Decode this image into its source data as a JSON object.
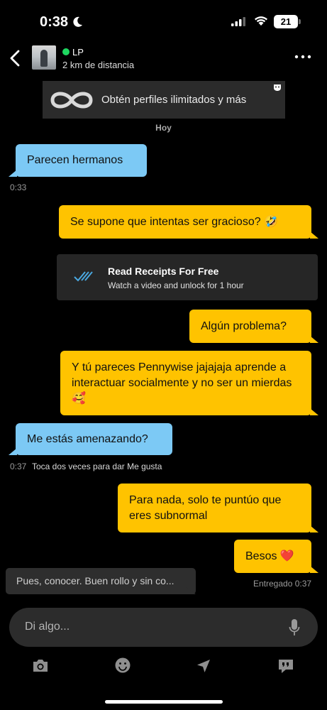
{
  "status_bar": {
    "time": "0:38",
    "battery": "21"
  },
  "header": {
    "name": "LP",
    "distance": "2 km de distancia"
  },
  "promo": {
    "text": "Obtén perfiles ilimitados y más"
  },
  "date_divider": "Hoy",
  "messages": [
    {
      "dir": "in",
      "text": "Parecen hermanos",
      "time": "0:33"
    },
    {
      "dir": "out",
      "text": "Se supone que intentas ser gracioso? 🤣"
    },
    {
      "dir": "out",
      "text": "Algún problema?"
    },
    {
      "dir": "out",
      "text": "Y tú pareces Pennywise jajajaja aprende a interactuar socialmente y no ser un mierdas 🥰"
    },
    {
      "dir": "in",
      "text": "Me estás amenazando?",
      "time": "0:37",
      "hint": "Toca dos veces para dar Me gusta"
    },
    {
      "dir": "out",
      "text": "Para nada, solo te puntúo que eres subnormal"
    },
    {
      "dir": "out",
      "text": "Besos ❤️"
    }
  ],
  "read_receipts": {
    "title": "Read Receipts For Free",
    "subtitle": "Watch a video and unlock for 1 hour"
  },
  "suggestion": "Pues, conocer. Buen rollo y sin co...",
  "delivered": "Entregado 0:37",
  "composer": {
    "placeholder": "Di algo..."
  },
  "icons": {
    "toolbar": [
      "camera-icon",
      "emoji-icon",
      "location-icon",
      "quick-replies-icon"
    ]
  },
  "colors": {
    "incoming": "#7cc9f5",
    "outgoing": "#ffc300",
    "background": "#000000"
  }
}
